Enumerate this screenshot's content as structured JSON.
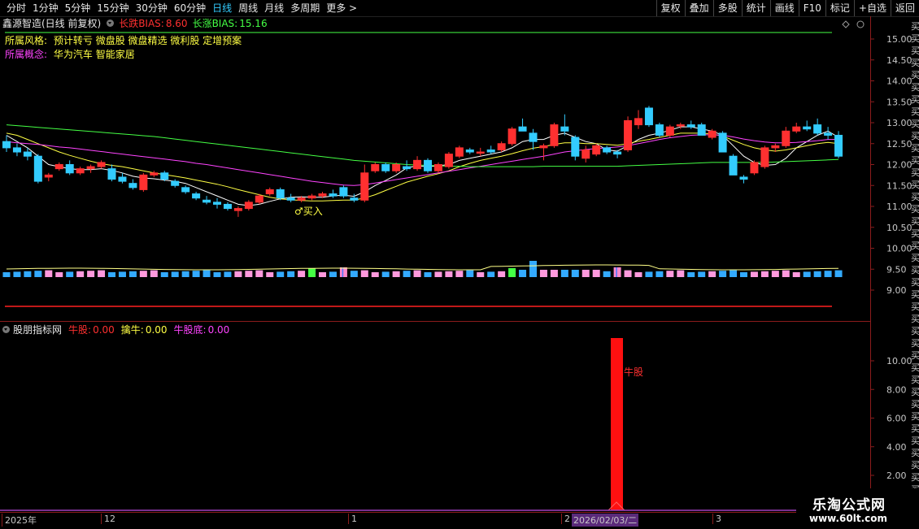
{
  "toolbar": {
    "periods": [
      "分时",
      "1分钟",
      "5分钟",
      "15分钟",
      "30分钟",
      "60分钟",
      "日线",
      "周线",
      "月线",
      "多周期",
      "更多"
    ],
    "active_period": "日线",
    "more_arrow": ">",
    "right_buttons": [
      "复权",
      "叠加",
      "多股",
      "统计",
      "画线",
      "F10",
      "标记",
      "+自选",
      "返回"
    ]
  },
  "main_legend": {
    "stock": "鑫源智造(日线 前复权)",
    "bias_down_label": "长跌BIAS:",
    "bias_down_value": "8.60",
    "bias_up_label": "长涨BIAS:",
    "bias_up_value": "15.16"
  },
  "info": {
    "style_label": "所属风格:",
    "style_value": "预计转亏 微盘股 微盘精选 微利股 定增预案",
    "concept_label": "所属概念:",
    "concept_value": "华为汽车 智能家居"
  },
  "price_axis": {
    "labels": [
      "15.00",
      "14.50",
      "14.00",
      "13.50",
      "13.00",
      "12.50",
      "12.00",
      "11.50",
      "11.00",
      "10.50",
      "10.00",
      "9.50",
      "9.00"
    ]
  },
  "buy_signal": "♂买入",
  "lower_legend": {
    "name": "股朋指标网",
    "bull_label": "牛股:",
    "bull_value": "0.00",
    "catch_label": "擒牛:",
    "catch_value": "0.00",
    "bottom_label": "牛股底:",
    "bottom_value": "0.00"
  },
  "lower_axis": {
    "labels": [
      "10.00",
      "8.00",
      "6.00",
      "4.00",
      "2.00"
    ]
  },
  "bull_bar": {
    "label": "牛股",
    "value": 10.0
  },
  "date_axis": {
    "year": "2025年",
    "m12": "12",
    "m1": "1",
    "m2": "2",
    "m3": "3",
    "highlight": "2026/02/03/二"
  },
  "right_strip": [
    "买",
    "买",
    "买",
    "买",
    "买",
    "买",
    "买",
    "买",
    "买",
    "买",
    "买",
    "买",
    "买",
    "买",
    "买",
    "买",
    "买",
    "买",
    "买",
    "买",
    "买",
    "买",
    "买",
    "买",
    "买",
    "买",
    "买",
    "买",
    "买",
    "买",
    "买",
    "买",
    "买",
    "买",
    "买",
    "买",
    "买",
    "买",
    "买",
    "买",
    "买"
  ],
  "watermark": {
    "title": "乐淘公式网",
    "url": "www.60lt.com"
  },
  "colors": {
    "up": "#ff3030",
    "down": "#33ccff",
    "ma_white": "#ffffff",
    "ma_yellow": "#ffff44",
    "ma_magenta": "#ff44ff",
    "ma_green": "#44ff44",
    "axis_red": "#8b1c1c"
  },
  "chart_data": {
    "type": "candlestick",
    "candles": [
      {
        "o": 12.55,
        "h": 12.7,
        "l": 12.3,
        "c": 12.4
      },
      {
        "o": 12.4,
        "h": 12.5,
        "l": 12.2,
        "c": 12.3
      },
      {
        "o": 12.3,
        "h": 12.4,
        "l": 12.1,
        "c": 12.2
      },
      {
        "o": 12.2,
        "h": 12.25,
        "l": 11.55,
        "c": 11.6
      },
      {
        "o": 11.7,
        "h": 11.8,
        "l": 11.6,
        "c": 11.75
      },
      {
        "o": 11.9,
        "h": 12.05,
        "l": 11.85,
        "c": 12.0
      },
      {
        "o": 12.0,
        "h": 12.1,
        "l": 11.75,
        "c": 11.8
      },
      {
        "o": 11.8,
        "h": 11.95,
        "l": 11.75,
        "c": 11.9
      },
      {
        "o": 11.9,
        "h": 12.0,
        "l": 11.8,
        "c": 11.95
      },
      {
        "o": 11.95,
        "h": 12.1,
        "l": 11.9,
        "c": 12.05
      },
      {
        "o": 11.9,
        "h": 12.0,
        "l": 11.6,
        "c": 11.65
      },
      {
        "o": 11.7,
        "h": 11.8,
        "l": 11.55,
        "c": 11.6
      },
      {
        "o": 11.55,
        "h": 11.65,
        "l": 11.4,
        "c": 11.45
      },
      {
        "o": 11.4,
        "h": 11.8,
        "l": 11.35,
        "c": 11.75
      },
      {
        "o": 11.75,
        "h": 11.85,
        "l": 11.7,
        "c": 11.8
      },
      {
        "o": 11.8,
        "h": 11.85,
        "l": 11.6,
        "c": 11.65
      },
      {
        "o": 11.6,
        "h": 11.65,
        "l": 11.45,
        "c": 11.5
      },
      {
        "o": 11.45,
        "h": 11.5,
        "l": 11.3,
        "c": 11.35
      },
      {
        "o": 11.3,
        "h": 11.35,
        "l": 11.15,
        "c": 11.2
      },
      {
        "o": 11.15,
        "h": 11.25,
        "l": 11.05,
        "c": 11.1
      },
      {
        "o": 11.1,
        "h": 11.2,
        "l": 10.95,
        "c": 11.05
      },
      {
        "o": 11.05,
        "h": 11.1,
        "l": 10.9,
        "c": 10.95
      },
      {
        "o": 10.9,
        "h": 11.0,
        "l": 10.75,
        "c": 10.95
      },
      {
        "o": 10.95,
        "h": 11.15,
        "l": 10.9,
        "c": 11.1
      },
      {
        "o": 11.1,
        "h": 11.3,
        "l": 11.05,
        "c": 11.25
      },
      {
        "o": 11.3,
        "h": 11.45,
        "l": 11.25,
        "c": 11.4
      },
      {
        "o": 11.4,
        "h": 11.45,
        "l": 11.15,
        "c": 11.2
      },
      {
        "o": 11.2,
        "h": 11.3,
        "l": 11.1,
        "c": 11.15
      },
      {
        "o": 11.15,
        "h": 11.25,
        "l": 11.1,
        "c": 11.2
      },
      {
        "o": 11.2,
        "h": 11.3,
        "l": 11.15,
        "c": 11.25
      },
      {
        "o": 11.25,
        "h": 11.35,
        "l": 11.2,
        "c": 11.3
      },
      {
        "o": 11.3,
        "h": 11.4,
        "l": 11.2,
        "c": 11.25
      },
      {
        "o": 11.45,
        "h": 11.5,
        "l": 11.2,
        "c": 11.25
      },
      {
        "o": 11.2,
        "h": 11.3,
        "l": 11.1,
        "c": 11.15
      },
      {
        "o": 11.15,
        "h": 12.0,
        "l": 11.1,
        "c": 11.8
      },
      {
        "o": 11.85,
        "h": 12.05,
        "l": 11.8,
        "c": 12.0
      },
      {
        "o": 12.0,
        "h": 12.05,
        "l": 11.8,
        "c": 11.85
      },
      {
        "o": 11.85,
        "h": 12.05,
        "l": 11.8,
        "c": 12.0
      },
      {
        "o": 11.95,
        "h": 12.1,
        "l": 11.85,
        "c": 11.9
      },
      {
        "o": 11.9,
        "h": 12.2,
        "l": 11.85,
        "c": 12.1
      },
      {
        "o": 12.1,
        "h": 12.15,
        "l": 11.8,
        "c": 11.85
      },
      {
        "o": 11.85,
        "h": 12.05,
        "l": 11.8,
        "c": 12.0
      },
      {
        "o": 11.95,
        "h": 12.3,
        "l": 11.9,
        "c": 12.25
      },
      {
        "o": 12.2,
        "h": 12.45,
        "l": 12.15,
        "c": 12.4
      },
      {
        "o": 12.35,
        "h": 12.4,
        "l": 12.25,
        "c": 12.3
      },
      {
        "o": 12.3,
        "h": 12.4,
        "l": 12.2,
        "c": 12.3
      },
      {
        "o": 12.35,
        "h": 12.45,
        "l": 12.25,
        "c": 12.3
      },
      {
        "o": 12.35,
        "h": 12.55,
        "l": 12.3,
        "c": 12.5
      },
      {
        "o": 12.5,
        "h": 12.9,
        "l": 12.45,
        "c": 12.85
      },
      {
        "o": 12.9,
        "h": 13.1,
        "l": 12.8,
        "c": 12.8
      },
      {
        "o": 12.75,
        "h": 12.85,
        "l": 12.35,
        "c": 12.55
      },
      {
        "o": 12.4,
        "h": 12.5,
        "l": 12.1,
        "c": 12.45
      },
      {
        "o": 12.45,
        "h": 13.0,
        "l": 12.4,
        "c": 12.95
      },
      {
        "o": 12.9,
        "h": 13.2,
        "l": 12.7,
        "c": 12.8
      },
      {
        "o": 12.65,
        "h": 12.7,
        "l": 12.1,
        "c": 12.2
      },
      {
        "o": 12.15,
        "h": 12.45,
        "l": 12.05,
        "c": 12.35
      },
      {
        "o": 12.25,
        "h": 12.5,
        "l": 12.2,
        "c": 12.45
      },
      {
        "o": 12.4,
        "h": 12.45,
        "l": 12.25,
        "c": 12.3
      },
      {
        "o": 12.3,
        "h": 12.35,
        "l": 12.15,
        "c": 12.25
      },
      {
        "o": 12.35,
        "h": 13.15,
        "l": 12.3,
        "c": 13.05
      },
      {
        "o": 12.95,
        "h": 13.3,
        "l": 12.85,
        "c": 13.1
      },
      {
        "o": 13.35,
        "h": 13.4,
        "l": 12.9,
        "c": 12.95
      },
      {
        "o": 12.95,
        "h": 13.0,
        "l": 12.65,
        "c": 12.7
      },
      {
        "o": 12.7,
        "h": 12.95,
        "l": 12.65,
        "c": 12.9
      },
      {
        "o": 12.95,
        "h": 13.0,
        "l": 12.85,
        "c": 12.95
      },
      {
        "o": 12.95,
        "h": 13.05,
        "l": 12.85,
        "c": 12.9
      },
      {
        "o": 12.95,
        "h": 13.0,
        "l": 12.7,
        "c": 12.7
      },
      {
        "o": 12.65,
        "h": 12.85,
        "l": 12.6,
        "c": 12.8
      },
      {
        "o": 12.75,
        "h": 12.8,
        "l": 12.3,
        "c": 12.3
      },
      {
        "o": 12.2,
        "h": 12.25,
        "l": 11.75,
        "c": 11.75
      },
      {
        "o": 11.7,
        "h": 11.75,
        "l": 11.55,
        "c": 11.65
      },
      {
        "o": 11.8,
        "h": 12.1,
        "l": 11.75,
        "c": 12.05
      },
      {
        "o": 11.95,
        "h": 12.45,
        "l": 11.9,
        "c": 12.4
      },
      {
        "o": 12.4,
        "h": 12.5,
        "l": 12.3,
        "c": 12.45
      },
      {
        "o": 12.45,
        "h": 12.9,
        "l": 12.4,
        "c": 12.8
      },
      {
        "o": 12.8,
        "h": 13.0,
        "l": 12.75,
        "c": 12.9
      },
      {
        "o": 12.9,
        "h": 13.05,
        "l": 12.8,
        "c": 12.85
      },
      {
        "o": 12.95,
        "h": 13.1,
        "l": 12.7,
        "c": 12.75
      },
      {
        "o": 12.75,
        "h": 12.9,
        "l": 12.6,
        "c": 12.7
      },
      {
        "o": 12.7,
        "h": 12.8,
        "l": 12.15,
        "c": 12.2
      }
    ],
    "ma": [
      {
        "name": "MA5",
        "color": "#ffffff",
        "values": [
          12.7,
          12.55,
          12.4,
          12.2,
          12.0,
          11.95,
          11.9,
          11.88,
          11.88,
          11.9,
          11.86,
          11.8,
          11.72,
          11.68,
          11.66,
          11.63,
          11.6,
          11.55,
          11.45,
          11.35,
          11.25,
          11.15,
          11.05,
          11.02,
          11.05,
          11.12,
          11.18,
          11.22,
          11.23,
          11.22,
          11.22,
          11.25,
          11.27,
          11.24,
          11.35,
          11.5,
          11.62,
          11.75,
          11.92,
          11.97,
          11.95,
          11.97,
          12.0,
          12.1,
          12.15,
          12.2,
          12.25,
          12.3,
          12.4,
          12.55,
          12.6,
          12.6,
          12.7,
          12.75,
          12.65,
          12.55,
          12.5,
          12.35,
          12.32,
          12.45,
          12.6,
          12.7,
          12.75,
          12.82,
          12.9,
          12.9,
          12.85,
          12.8,
          12.7,
          12.45,
          12.2,
          12.05,
          11.98,
          12.0,
          12.15,
          12.4,
          12.55,
          12.7,
          12.8,
          12.65
        ]
      },
      {
        "name": "MA10",
        "color": "#ffff44",
        "values": [
          12.75,
          12.7,
          12.6,
          12.5,
          12.4,
          12.3,
          12.22,
          12.15,
          12.08,
          12.02,
          11.98,
          11.95,
          11.9,
          11.85,
          11.8,
          11.76,
          11.72,
          11.68,
          11.63,
          11.58,
          11.53,
          11.47,
          11.4,
          11.34,
          11.28,
          11.22,
          11.18,
          11.16,
          11.14,
          11.13,
          11.13,
          11.14,
          11.15,
          11.15,
          11.2,
          11.28,
          11.38,
          11.48,
          11.58,
          11.65,
          11.72,
          11.78,
          11.85,
          11.95,
          12.03,
          12.1,
          12.15,
          12.2,
          12.26,
          12.33,
          12.39,
          12.43,
          12.48,
          12.52,
          12.52,
          12.5,
          12.5,
          12.48,
          12.46,
          12.5,
          12.56,
          12.6,
          12.65,
          12.7,
          12.75,
          12.75,
          12.75,
          12.73,
          12.68,
          12.58,
          12.48,
          12.4,
          12.35,
          12.32,
          12.35,
          12.4,
          12.45,
          12.5,
          12.53,
          12.5
        ]
      },
      {
        "name": "MA30",
        "color": "#ff44ff",
        "values": [
          12.55,
          12.52,
          12.5,
          12.48,
          12.45,
          12.42,
          12.4,
          12.37,
          12.34,
          12.31,
          12.28,
          12.25,
          12.22,
          12.19,
          12.16,
          12.13,
          12.1,
          12.07,
          12.03,
          12.0,
          11.96,
          11.92,
          11.88,
          11.84,
          11.8,
          11.76,
          11.72,
          11.68,
          11.64,
          11.6,
          11.57,
          11.54,
          11.51,
          11.5,
          11.52,
          11.56,
          11.6,
          11.64,
          11.68,
          11.72,
          11.76,
          11.8,
          11.84,
          11.88,
          11.92,
          11.96,
          12.0,
          12.04,
          12.08,
          12.12,
          12.16,
          12.2,
          12.25,
          12.3,
          12.33,
          12.36,
          12.38,
          12.4,
          12.42,
          12.45,
          12.5,
          12.55,
          12.6,
          12.64,
          12.67,
          12.7,
          12.71,
          12.71,
          12.7,
          12.66,
          12.61,
          12.57,
          12.54,
          12.52,
          12.52,
          12.53,
          12.55,
          12.57,
          12.6,
          12.6
        ]
      },
      {
        "name": "MA60",
        "color": "#44ff44",
        "values": [
          12.95,
          12.93,
          12.91,
          12.89,
          12.87,
          12.85,
          12.83,
          12.81,
          12.79,
          12.77,
          12.75,
          12.73,
          12.71,
          12.69,
          12.67,
          12.64,
          12.61,
          12.58,
          12.55,
          12.52,
          12.49,
          12.46,
          12.43,
          12.4,
          12.37,
          12.34,
          12.31,
          12.28,
          12.25,
          12.22,
          12.19,
          12.16,
          12.13,
          12.1,
          12.08,
          12.06,
          12.04,
          12.02,
          12.0,
          11.99,
          11.98,
          11.97,
          11.96,
          11.96,
          11.95,
          11.95,
          11.95,
          11.95,
          11.95,
          11.95,
          11.95,
          11.96,
          11.96,
          11.96,
          11.96,
          11.96,
          11.96,
          11.96,
          11.96,
          11.97,
          11.98,
          11.99,
          12.0,
          12.01,
          12.02,
          12.03,
          12.04,
          12.05,
          12.05,
          12.05,
          12.05,
          12.05,
          12.05,
          12.06,
          12.07,
          12.08,
          12.09,
          12.1,
          12.11,
          12.12
        ]
      }
    ],
    "volume_highlights": {
      "green": [
        29,
        48
      ],
      "striped": [
        32,
        58
      ]
    },
    "price_ylim": [
      8.7,
      15.3
    ],
    "lower_ylim": [
      0,
      11
    ],
    "bull_index": 57
  }
}
